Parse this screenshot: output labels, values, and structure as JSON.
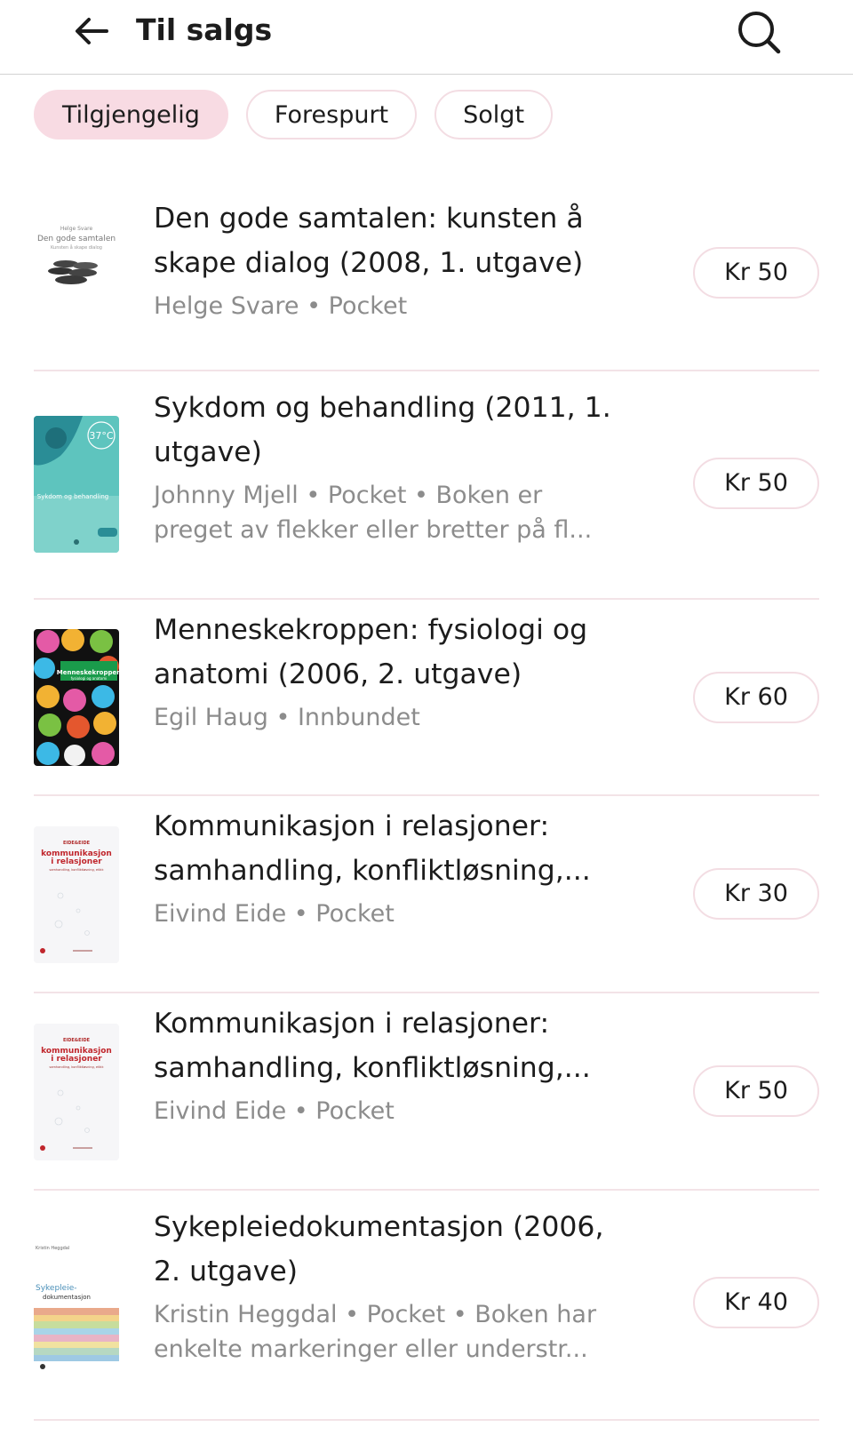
{
  "header": {
    "title": "Til salgs",
    "back_icon": "arrow-left-icon",
    "search_icon": "search-icon"
  },
  "tabs": [
    {
      "label": "Tilgjengelig",
      "active": true
    },
    {
      "label": "Forespurt",
      "active": false
    },
    {
      "label": "Solgt",
      "active": false
    }
  ],
  "colors": {
    "accent_chip": "#f8dbe3",
    "chip_border": "#f3dde3",
    "divider": "#f3e3e7",
    "meta_text": "#8c8c8c"
  },
  "items": [
    {
      "title_line1": "Den gode samtalen: kunsten å",
      "title_line2": "skape dialog (2008, 1. utgave)",
      "meta_line1": "Helge Svare • Pocket",
      "meta_line2": "",
      "price": "Kr 50",
      "cover": {
        "author": "Helge Svare",
        "title": "Den gode samtalen",
        "subtitle": "Kunsten å skape dialog"
      }
    },
    {
      "title_line1": "Sykdom og behandling (2011, 1.",
      "title_line2": "utgave)",
      "meta_line1": "Johnny Mjell • Pocket • Boken er",
      "meta_line2": "preget av flekker eller bretter på fl...",
      "price": "Kr 50",
      "cover": {
        "badge": "37°C",
        "title": "Sykdom og behandling"
      }
    },
    {
      "title_line1": "Menneskekroppen: fysiologi og",
      "title_line2": "anatomi (2006, 2. utgave)",
      "meta_line1": "Egil Haug • Innbundet",
      "meta_line2": "",
      "price": "Kr 60",
      "cover": {
        "title": "Menneskekroppen",
        "subtitle": "fysiologi og anatomi"
      }
    },
    {
      "title_line1": "Kommunikasjon i relasjoner:",
      "title_line2": "samhandling, konfliktløsning,...",
      "meta_line1": "Eivind Eide • Pocket",
      "meta_line2": "",
      "price": "Kr 30",
      "cover": {
        "publisher": "EIDE&EIDE",
        "title_a": "kommunikasjon",
        "title_b": "i relasjoner",
        "subtitle": "samhandling, konfliktløsning, etikk"
      }
    },
    {
      "title_line1": "Kommunikasjon i relasjoner:",
      "title_line2": "samhandling, konfliktløsning,...",
      "meta_line1": "Eivind Eide • Pocket",
      "meta_line2": "",
      "price": "Kr 50",
      "cover": {
        "publisher": "EIDE&EIDE",
        "title_a": "kommunikasjon",
        "title_b": "i relasjoner",
        "subtitle": "samhandling, konfliktløsning, etikk"
      }
    },
    {
      "title_line1": "Sykepleiedokumentasjon (2006,",
      "title_line2": "2. utgave)",
      "meta_line1": "Kristin Heggdal • Pocket • Boken har",
      "meta_line2": "enkelte markeringer eller understr...",
      "price": "Kr 40",
      "cover": {
        "author": "Kristin Heggdal",
        "title_a": "Sykepleie-",
        "title_b": "dokumentasjon"
      }
    }
  ]
}
